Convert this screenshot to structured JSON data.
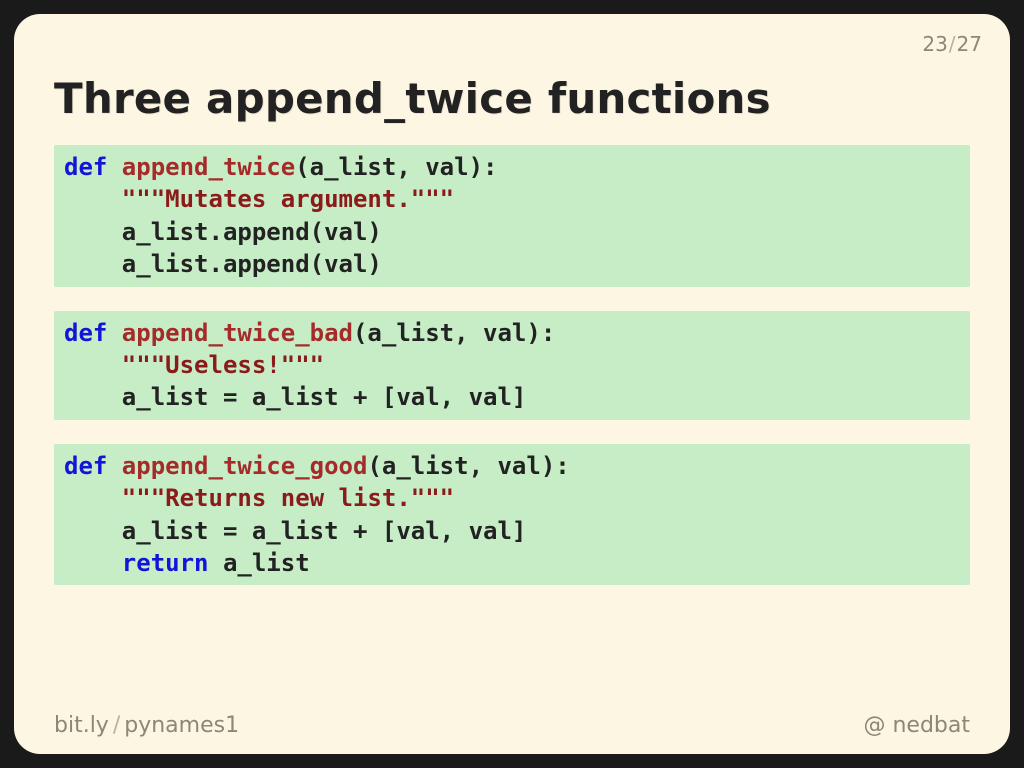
{
  "page": {
    "current": "23",
    "total": "27"
  },
  "title": "Three append_twice functions",
  "code": {
    "b1": {
      "l1_def": "def ",
      "l1_name": "append_twice",
      "l1_rest": "(a_list, val):",
      "l2_indent": "    ",
      "l2_doc": "\"\"\"Mutates argument.\"\"\"",
      "l3": "    a_list.append(val)",
      "l4": "    a_list.append(val)"
    },
    "b2": {
      "l1_def": "def ",
      "l1_name": "append_twice_bad",
      "l1_rest": "(a_list, val):",
      "l2_indent": "    ",
      "l2_doc": "\"\"\"Useless!\"\"\"",
      "l3": "    a_list = a_list + [val, val]"
    },
    "b3": {
      "l1_def": "def ",
      "l1_name": "append_twice_good",
      "l1_rest": "(a_list, val):",
      "l2_indent": "    ",
      "l2_doc": "\"\"\"Returns new list.\"\"\"",
      "l3": "    a_list = a_list + [val, val]",
      "l4_indent": "    ",
      "l4_kw": "return",
      "l4_rest": " a_list"
    }
  },
  "footer": {
    "link_host": "bit.ly",
    "link_path": "pynames1",
    "at": "@",
    "handle": "nedbat"
  }
}
